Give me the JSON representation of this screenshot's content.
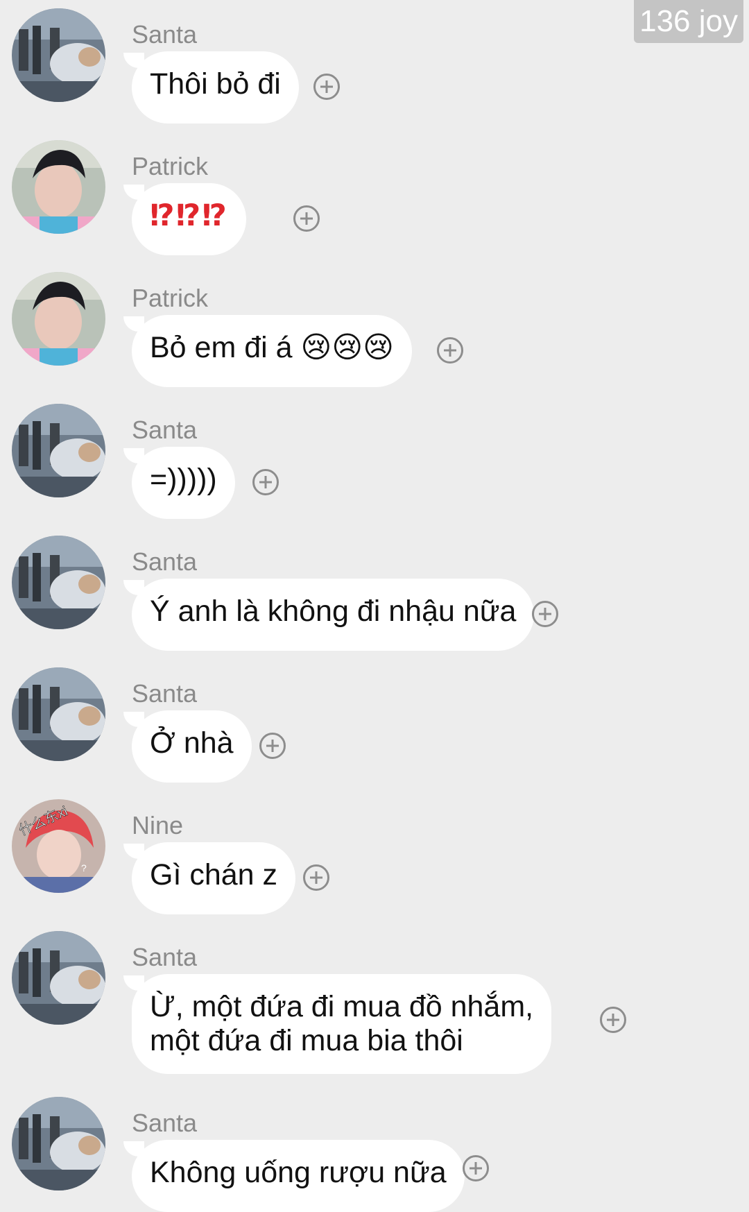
{
  "watermark": "136 joy",
  "colors": {
    "background": "#ededed",
    "bubble": "#ffffff",
    "name_text": "#8a8a8a",
    "alert_red": "#e0262c"
  },
  "messages": [
    {
      "sender": "Santa",
      "text": "Thôi bỏ đi",
      "avatar": "santa-avatar"
    },
    {
      "sender": "Patrick",
      "text": "⁉⁉⁉",
      "avatar": "patrick-avatar"
    },
    {
      "sender": "Patrick",
      "text": "Bỏ em đi á 😢😢😢",
      "avatar": "patrick-avatar"
    },
    {
      "sender": "Santa",
      "text": "=)))))",
      "avatar": "santa-avatar"
    },
    {
      "sender": "Santa",
      "text": "Ý anh là không đi nhậu nữa",
      "avatar": "santa-avatar"
    },
    {
      "sender": "Santa",
      "text": "Ở nhà",
      "avatar": "santa-avatar"
    },
    {
      "sender": "Nine",
      "text": "Gì chán z",
      "avatar": "nine-avatar",
      "avatar_caption": "什么东xi"
    },
    {
      "sender": "Santa",
      "text": "Ừ, một đứa đi mua đồ nhắm,\nmột đứa đi mua bia thôi",
      "avatar": "santa-avatar"
    },
    {
      "sender": "Santa",
      "text": "Không uống rượu nữa",
      "avatar": "santa-avatar"
    }
  ]
}
